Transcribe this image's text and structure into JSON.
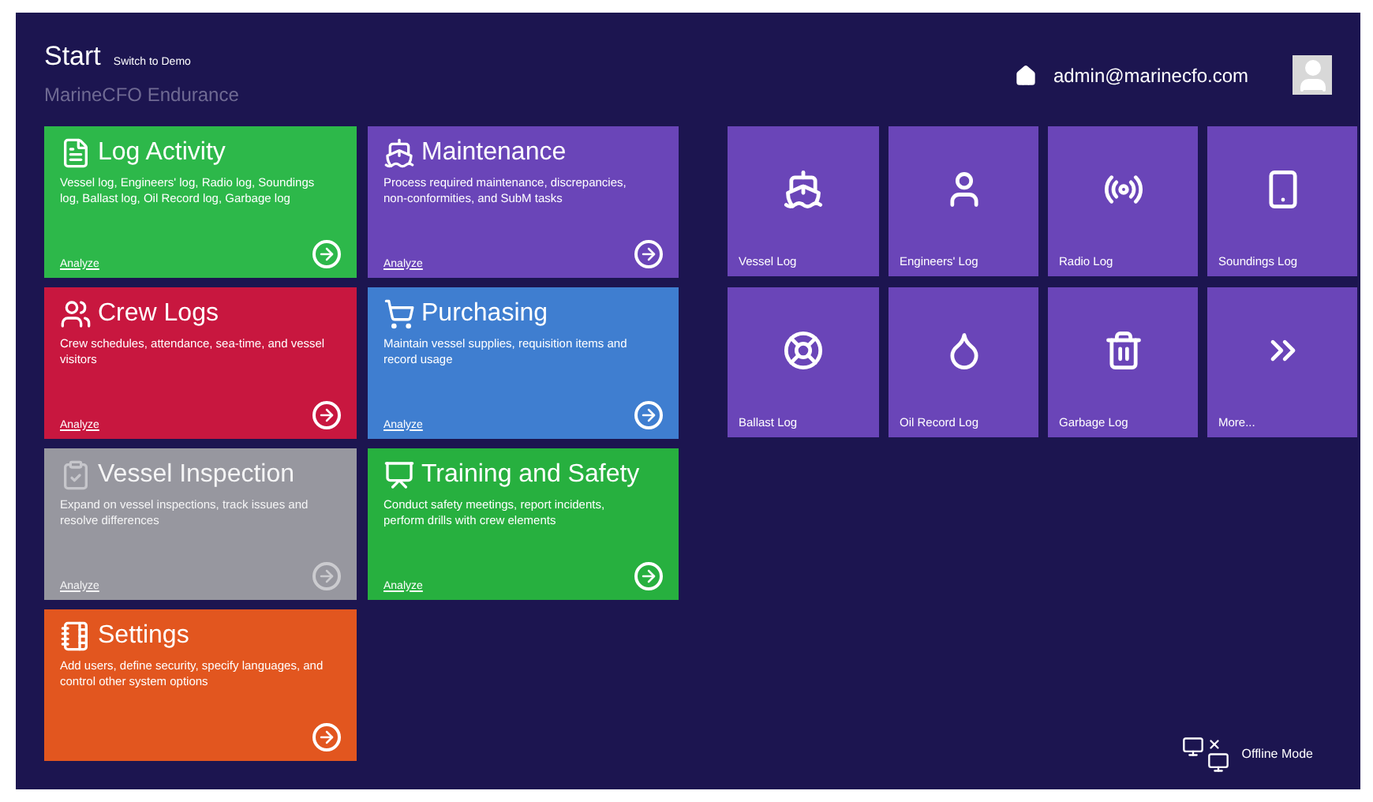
{
  "header": {
    "title": "Start",
    "switch_link": "Switch to Demo",
    "subtitle": "MarineCFO Endurance",
    "user": "admin@marinecfo.com"
  },
  "modules": [
    {
      "title": "Log Activity",
      "color": "#2db84a",
      "disabled": false,
      "description": "Vessel log, Engineers' log, Radio log, Soundings log, Ballast log, Oil Record log, Garbage log",
      "link": "Analyze"
    },
    {
      "title": "Maintenance",
      "color": "#6a45b8",
      "disabled": false,
      "description": "Process required maintenance, discrepancies, non-conformities, and SubM tasks",
      "link": "Analyze"
    },
    {
      "title": "Crew Logs",
      "color": "#c8173f",
      "disabled": false,
      "description": "Crew schedules, attendance, sea-time, and vessel visitors",
      "link": "Analyze"
    },
    {
      "title": "Purchasing",
      "color": "#3f7ed0",
      "disabled": false,
      "description": "Maintain vessel supplies, requisition items and record usage",
      "link": "Analyze"
    },
    {
      "title": "Vessel Inspection",
      "color": "#97979f",
      "disabled": true,
      "description": "Expand on vessel inspections, track issues and resolve differences",
      "link": "Analyze"
    },
    {
      "title": "Training and Safety",
      "color": "#27b03f",
      "disabled": false,
      "description": "Conduct safety meetings, report incidents, perform drills with crew elements",
      "link": "Analyze"
    },
    {
      "title": "Settings",
      "color": "#e2561f",
      "disabled": false,
      "description": "Add users, define security, specify languages, and control other system options"
    }
  ],
  "log_tiles": [
    {
      "label": "Vessel Log"
    },
    {
      "label": "Engineers' Log"
    },
    {
      "label": "Radio Log"
    },
    {
      "label": "Soundings Log"
    },
    {
      "label": "Ballast Log"
    },
    {
      "label": "Oil Record Log"
    },
    {
      "label": "Garbage Log"
    },
    {
      "label": "More..."
    }
  ],
  "status": {
    "offline_label": "Offline Mode"
  }
}
